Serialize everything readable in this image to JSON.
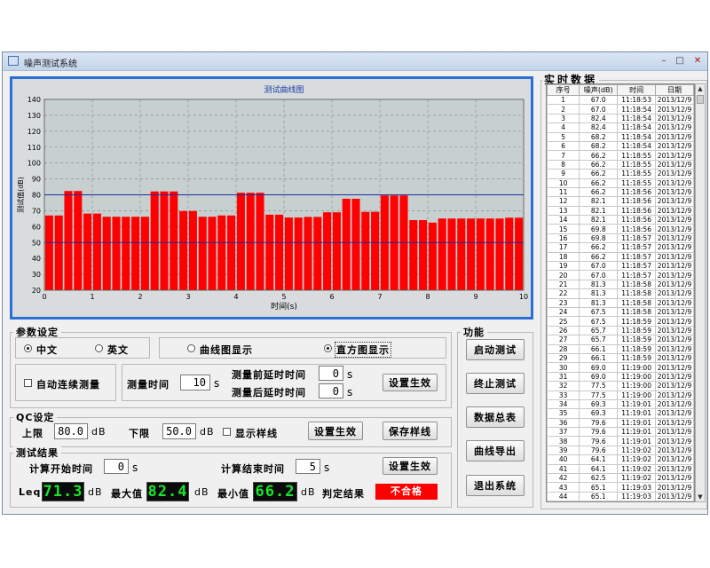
{
  "window": {
    "title": "噪声测试系统",
    "minimize": "–",
    "maximize": "□",
    "close": "✕"
  },
  "colors": {
    "accent": "#2b6fd6",
    "bar": "#ff0000",
    "limit_line": "#1a2ea8",
    "lcd_text": "#19e62a",
    "verdict_bg": "#ff0000"
  },
  "chart_data": {
    "type": "bar",
    "title": "测试曲线图",
    "xlabel": "时间(s)",
    "ylabel": "测试值(dB)",
    "xlim": [
      0,
      10
    ],
    "ylim": [
      20,
      140
    ],
    "xticks": [
      0,
      1,
      2,
      3,
      4,
      5,
      6,
      7,
      8,
      9,
      10
    ],
    "yticks": [
      20,
      30,
      40,
      50,
      60,
      70,
      80,
      90,
      100,
      110,
      120,
      130,
      140
    ],
    "grid": true,
    "upper_limit": 80.0,
    "lower_limit": 50.0,
    "values": [
      67.0,
      67.0,
      82.4,
      82.4,
      68.2,
      68.2,
      66.2,
      66.2,
      66.2,
      66.2,
      66.2,
      82.1,
      82.1,
      82.1,
      69.8,
      69.8,
      66.2,
      66.2,
      67.0,
      67.0,
      81.3,
      81.3,
      81.3,
      67.5,
      67.5,
      65.7,
      65.7,
      66.1,
      66.1,
      69.0,
      69.0,
      77.5,
      77.5,
      69.3,
      69.3,
      79.6,
      79.6,
      79.6,
      64.1,
      64.1,
      62.5,
      65.1,
      65.1,
      65.1,
      65.1,
      65.1,
      65.1,
      65.1,
      65.6,
      65.6
    ]
  },
  "params": {
    "group_title": "参数设定",
    "lang_cn": "中文",
    "lang_en": "英文",
    "curve_display": "曲线图显示",
    "histogram_display": "直方图显示",
    "auto_measure": "自动连续测量",
    "measure_time_label": "测量时间",
    "measure_time": "10",
    "pre_delay_label": "测量前延时时间",
    "pre_delay": "0",
    "post_delay_label": "测量后延时时间",
    "post_delay": "0",
    "unit_s": "s",
    "apply": "设置生效"
  },
  "qc": {
    "group_title": "QC设定",
    "upper_label": "上限",
    "upper": "80.0",
    "lower_label": "下限",
    "lower": "50.0",
    "unit_db": "dB",
    "show_sample": "显示样线",
    "apply": "设置生效",
    "save_sample": "保存样线"
  },
  "results": {
    "group_title": "测试结果",
    "start_label": "计算开始时间",
    "start": "0",
    "end_label": "计算结束时间",
    "end": "5",
    "unit_s": "s",
    "apply": "设置生效",
    "leq_label": "Leq",
    "leq": "71.3",
    "max_label": "最大值",
    "max": "82.4",
    "min_label": "最小值",
    "min": "66.2",
    "unit_db": "dB",
    "verdict_label": "判定结果",
    "verdict": "不合格"
  },
  "functions": {
    "group_title": "功能",
    "start": "启动测试",
    "stop": "终止测试",
    "summary": "数据总表",
    "export": "曲线导出",
    "exit": "退出系统"
  },
  "realtime": {
    "title": "实时数据",
    "columns": [
      "序号",
      "噪声(dB)",
      "时间",
      "日期"
    ],
    "rows": [
      [
        "1",
        "67.0",
        "11:18:53",
        "2013/12/9"
      ],
      [
        "2",
        "67.0",
        "11:18:54",
        "2013/12/9"
      ],
      [
        "3",
        "82.4",
        "11:18:54",
        "2013/12/9"
      ],
      [
        "4",
        "82.4",
        "11:18:54",
        "2013/12/9"
      ],
      [
        "5",
        "68.2",
        "11:18:54",
        "2013/12/9"
      ],
      [
        "6",
        "68.2",
        "11:18:54",
        "2013/12/9"
      ],
      [
        "7",
        "66.2",
        "11:18:55",
        "2013/12/9"
      ],
      [
        "8",
        "66.2",
        "11:18:55",
        "2013/12/9"
      ],
      [
        "9",
        "66.2",
        "11:18:55",
        "2013/12/9"
      ],
      [
        "10",
        "66.2",
        "11:18:55",
        "2013/12/9"
      ],
      [
        "11",
        "66.2",
        "11:18:56",
        "2013/12/9"
      ],
      [
        "12",
        "82.1",
        "11:18:56",
        "2013/12/9"
      ],
      [
        "13",
        "82.1",
        "11:18:56",
        "2013/12/9"
      ],
      [
        "14",
        "82.1",
        "11:18:56",
        "2013/12/9"
      ],
      [
        "15",
        "69.8",
        "11:18:56",
        "2013/12/9"
      ],
      [
        "16",
        "69.8",
        "11:18:57",
        "2013/12/9"
      ],
      [
        "17",
        "66.2",
        "11:18:57",
        "2013/12/9"
      ],
      [
        "18",
        "66.2",
        "11:18:57",
        "2013/12/9"
      ],
      [
        "19",
        "67.0",
        "11:18:57",
        "2013/12/9"
      ],
      [
        "20",
        "67.0",
        "11:18:57",
        "2013/12/9"
      ],
      [
        "21",
        "81.3",
        "11:18:58",
        "2013/12/9"
      ],
      [
        "22",
        "81.3",
        "11:18:58",
        "2013/12/9"
      ],
      [
        "23",
        "81.3",
        "11:18:58",
        "2013/12/9"
      ],
      [
        "24",
        "67.5",
        "11:18:58",
        "2013/12/9"
      ],
      [
        "25",
        "67.5",
        "11:18:59",
        "2013/12/9"
      ],
      [
        "26",
        "65.7",
        "11:18:59",
        "2013/12/9"
      ],
      [
        "27",
        "65.7",
        "11:18:59",
        "2013/12/9"
      ],
      [
        "28",
        "66.1",
        "11:18:59",
        "2013/12/9"
      ],
      [
        "29",
        "66.1",
        "11:18:59",
        "2013/12/9"
      ],
      [
        "30",
        "69.0",
        "11:19:00",
        "2013/12/9"
      ],
      [
        "31",
        "69.0",
        "11:19:00",
        "2013/12/9"
      ],
      [
        "32",
        "77.5",
        "11:19:00",
        "2013/12/9"
      ],
      [
        "33",
        "77.5",
        "11:19:00",
        "2013/12/9"
      ],
      [
        "34",
        "69.3",
        "11:19:01",
        "2013/12/9"
      ],
      [
        "35",
        "69.3",
        "11:19:01",
        "2013/12/9"
      ],
      [
        "36",
        "79.6",
        "11:19:01",
        "2013/12/9"
      ],
      [
        "37",
        "79.6",
        "11:19:01",
        "2013/12/9"
      ],
      [
        "38",
        "79.6",
        "11:19:01",
        "2013/12/9"
      ],
      [
        "39",
        "79.6",
        "11:19:02",
        "2013/12/9"
      ],
      [
        "40",
        "64.1",
        "11:19:02",
        "2013/12/9"
      ],
      [
        "41",
        "64.1",
        "11:19:02",
        "2013/12/9"
      ],
      [
        "42",
        "62.5",
        "11:19:02",
        "2013/12/9"
      ],
      [
        "43",
        "65.1",
        "11:19:03",
        "2013/12/9"
      ],
      [
        "44",
        "65.1",
        "11:19:03",
        "2013/12/9"
      ]
    ]
  }
}
